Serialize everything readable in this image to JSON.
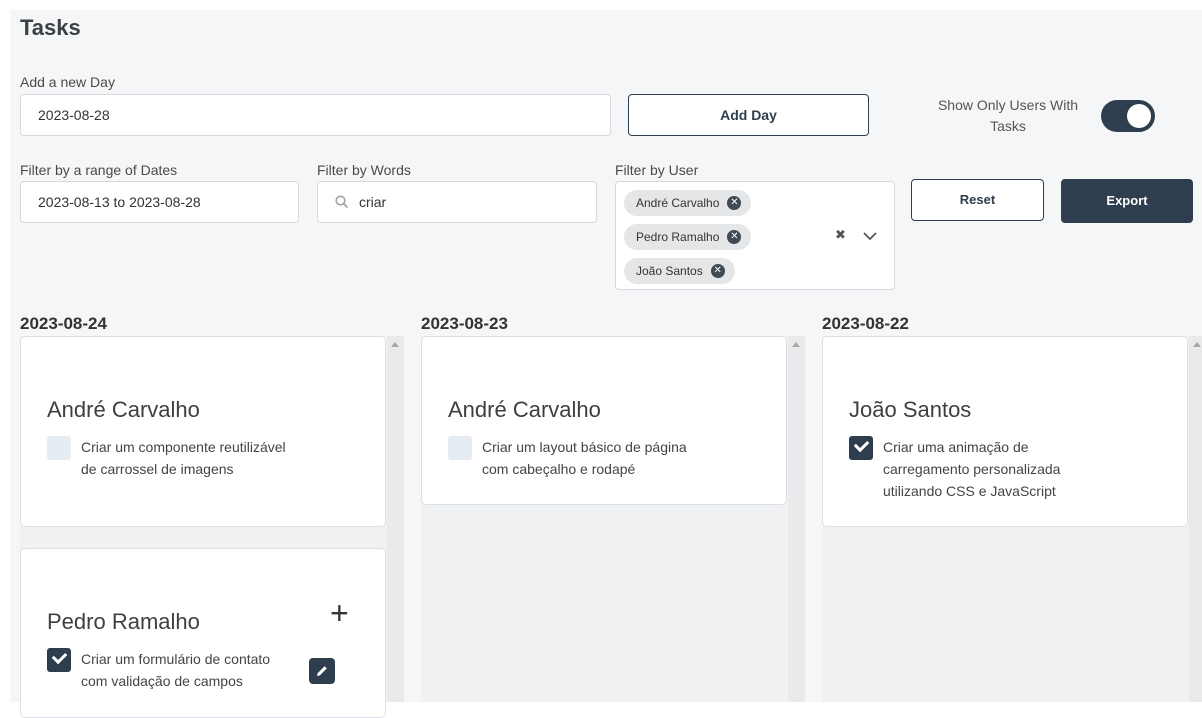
{
  "page": {
    "title": "Tasks"
  },
  "add_day": {
    "label": "Add a new Day",
    "value": "2023-08-28",
    "button": "Add Day"
  },
  "toggle": {
    "label": "Show Only Users With Tasks",
    "on": true
  },
  "filters": {
    "date_label": "Filter by a range of Dates",
    "date_value": "2023-08-13 to 2023-08-28",
    "words_label": "Filter by Words",
    "words_value": "criar",
    "user_label": "Filter by User",
    "users": [
      "André Carvalho",
      "Pedro Ramalho",
      "João Santos"
    ]
  },
  "actions": {
    "reset": "Reset",
    "export": "Export"
  },
  "colors": {
    "primary": "#2f3e4e",
    "chip_bg": "#e4e6e8",
    "checkbox_empty": "#e6ecf3"
  },
  "days": [
    {
      "date": "2023-08-24",
      "users": [
        {
          "name": "André Carvalho",
          "tasks": [
            {
              "text": "Criar um componente reutilizável de carrossel de imagens",
              "done": false
            }
          ]
        },
        {
          "name": "Pedro Ramalho",
          "tasks": [
            {
              "text": "Criar um formulário de contato com validação de campos",
              "done": true
            }
          ]
        }
      ]
    },
    {
      "date": "2023-08-23",
      "users": [
        {
          "name": "André Carvalho",
          "tasks": [
            {
              "text": "Criar um layout básico de página com cabeçalho e rodapé",
              "done": false
            }
          ]
        }
      ]
    },
    {
      "date": "2023-08-22",
      "users": [
        {
          "name": "João Santos",
          "tasks": [
            {
              "text": "Criar uma animação de carregamento personalizada utilizando CSS e JavaScript",
              "done": true
            }
          ]
        }
      ]
    }
  ]
}
